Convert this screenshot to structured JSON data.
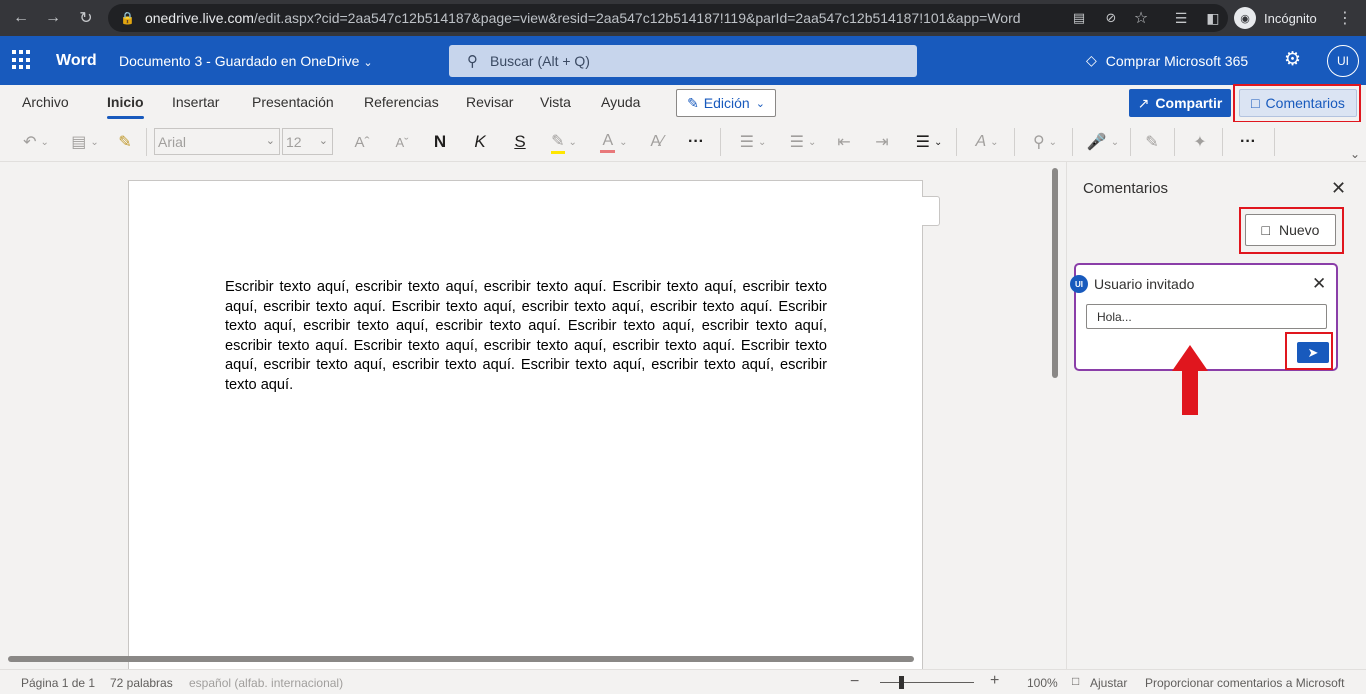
{
  "browser": {
    "url_host": "onedrive.live.com",
    "url_path": "/edit.aspx?cid=2aa547c12b514187&page=view&resid=2aa547c12b514187!119&parId=2aa547c12b514187!101&app=Word",
    "incognito_label": "Incógnito"
  },
  "app": {
    "name": "Word",
    "doc_title": "Documento 3  -  Guardado en OneDrive",
    "search_placeholder": "Buscar (Alt + Q)",
    "buy_label": "Comprar Microsoft 365",
    "user_initials": "UI"
  },
  "tabs": [
    "Archivo",
    "Inicio",
    "Insertar",
    "Presentación",
    "Referencias",
    "Revisar",
    "Vista",
    "Ayuda"
  ],
  "ribbon": {
    "edit_mode": "Edición",
    "share_label": "Compartir",
    "comments_label": "Comentarios"
  },
  "toolbar": {
    "font_name": "Arial",
    "font_size": "12",
    "bold_glyph": "N",
    "italic_glyph": "K",
    "underline_glyph": "S",
    "grow_glyph": "Aˆ",
    "shrink_glyph": "Aˇ",
    "more_glyph": "···"
  },
  "document": {
    "body": "Escribir texto aquí, escribir texto aquí, escribir texto aquí. Escribir texto aquí, escribir texto aquí, escribir texto aquí. Escribir texto aquí, escribir texto aquí, escribir texto aquí. Escribir texto aquí, escribir texto aquí, escribir texto aquí. Escribir texto aquí, escribir texto aquí, escribir texto aquí. Escribir texto aquí, escribir texto aquí, escribir texto aquí. Escribir texto aquí, escribir texto aquí, escribir texto aquí. Escribir texto aquí, escribir texto aquí, escribir texto aquí."
  },
  "comments_pane": {
    "title": "Comentarios",
    "new_label": "Nuevo",
    "author": "Usuario invitado",
    "author_initials": "UI",
    "draft_text": "Hola..."
  },
  "status": {
    "page": "Página 1 de 1",
    "words": "72 palabras",
    "language": "español (alfab. internacional)",
    "zoom": "100%",
    "fit_label": "Ajustar",
    "feedback": "Proporcionar comentarios a Microsoft"
  },
  "colors": {
    "brand": "#185abd",
    "highlight_box": "#e0161e",
    "card_border": "#8a3ea8"
  },
  "icons": [
    "back-icon",
    "forward-icon",
    "reload-icon",
    "lock-icon",
    "waffle-icon",
    "search-icon",
    "diamond-icon",
    "gear-icon",
    "undo-icon",
    "paste-icon",
    "format-painter-icon",
    "highlight-icon",
    "font-color-icon",
    "clear-format-icon",
    "bullets-icon",
    "numbering-icon",
    "outdent-icon",
    "indent-icon",
    "align-icon",
    "styles-icon",
    "find-icon",
    "dictate-icon",
    "editor-icon",
    "designer-icon",
    "comment-icon",
    "close-icon",
    "send-icon",
    "arrow-up-icon"
  ]
}
